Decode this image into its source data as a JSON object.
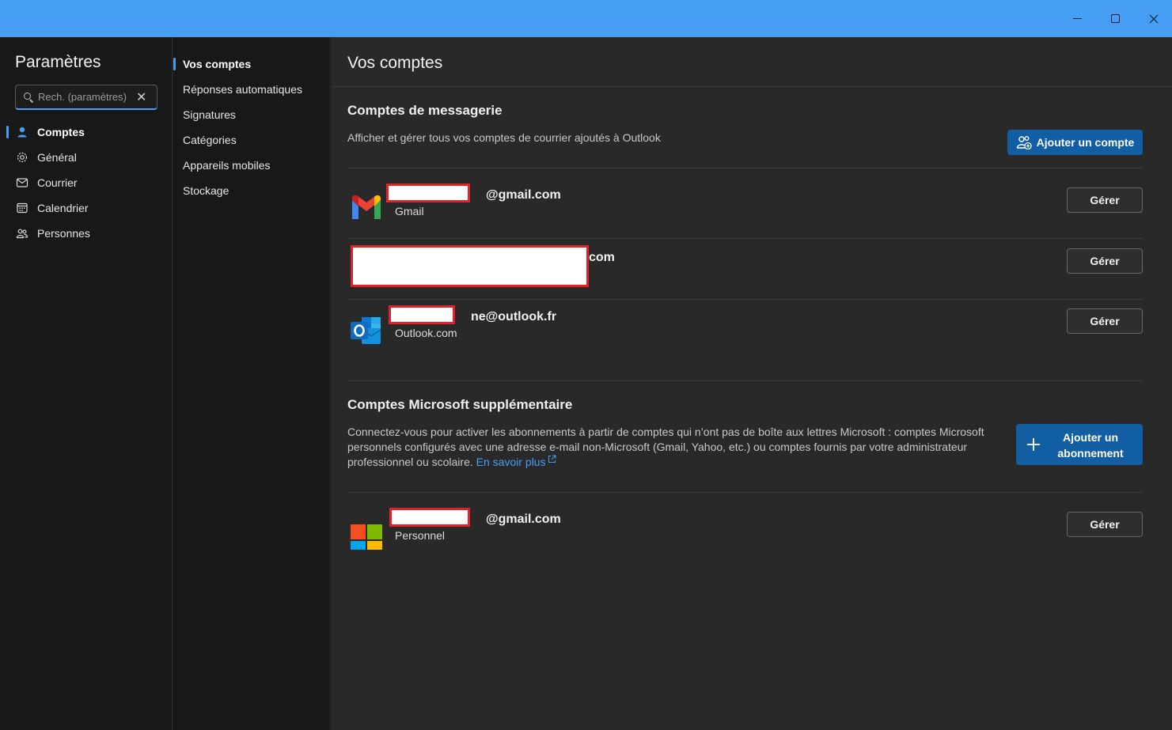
{
  "window": {
    "minimize_icon": "minimize-icon",
    "maximize_icon": "maximize-icon",
    "close_icon": "close-icon"
  },
  "sidebar": {
    "title": "Paramètres",
    "search_placeholder": "Rech. (paramètres)",
    "items": [
      {
        "label": "Comptes",
        "icon": "person-icon",
        "active": true
      },
      {
        "label": "Général",
        "icon": "gear-icon"
      },
      {
        "label": "Courrier",
        "icon": "mail-icon"
      },
      {
        "label": "Calendrier",
        "icon": "calendar-icon"
      },
      {
        "label": "Personnes",
        "icon": "people-icon"
      }
    ]
  },
  "subnav": {
    "items": [
      {
        "label": "Vos comptes",
        "active": true
      },
      {
        "label": "Réponses automatiques"
      },
      {
        "label": "Signatures"
      },
      {
        "label": "Catégories"
      },
      {
        "label": "Appareils mobiles"
      },
      {
        "label": "Stockage"
      }
    ]
  },
  "main": {
    "title": "Vos comptes",
    "mail_accounts": {
      "heading": "Comptes de messagerie",
      "description": "Afficher et gérer tous vos comptes de courrier ajoutés à Outlook",
      "add_button": "Ajouter un compte",
      "accounts": [
        {
          "email_suffix": "@gmail.com",
          "type": "Gmail",
          "logo": "gmail-icon",
          "manage": "Gérer"
        },
        {
          "email_suffix": "com",
          "type": "",
          "logo": "",
          "manage": "Gérer"
        },
        {
          "email_suffix": "ne@outlook.fr",
          "type": "Outlook.com",
          "logo": "outlook-icon",
          "manage": "Gérer"
        }
      ]
    },
    "microsoft_accounts": {
      "heading": "Comptes Microsoft supplémentaire",
      "description": "Connectez-vous pour activer les abonnements à partir de comptes qui n’ont pas de boîte aux lettres Microsoft : comptes Microsoft personnels configurés avec une adresse e-mail non-Microsoft (Gmail, Yahoo, etc.) ou comptes fournis par votre administrateur professionnel ou scolaire.",
      "learn_more": "En savoir plus",
      "add_button_line1": "Ajouter un",
      "add_button_line2": "abonnement",
      "accounts": [
        {
          "email_suffix": "@gmail.com",
          "type": "Personnel",
          "logo": "microsoft-icon",
          "manage": "Gérer"
        }
      ]
    }
  },
  "colors": {
    "accent": "#479ef5",
    "primary_button": "#115ea3",
    "redaction_border": "#e0222b"
  }
}
